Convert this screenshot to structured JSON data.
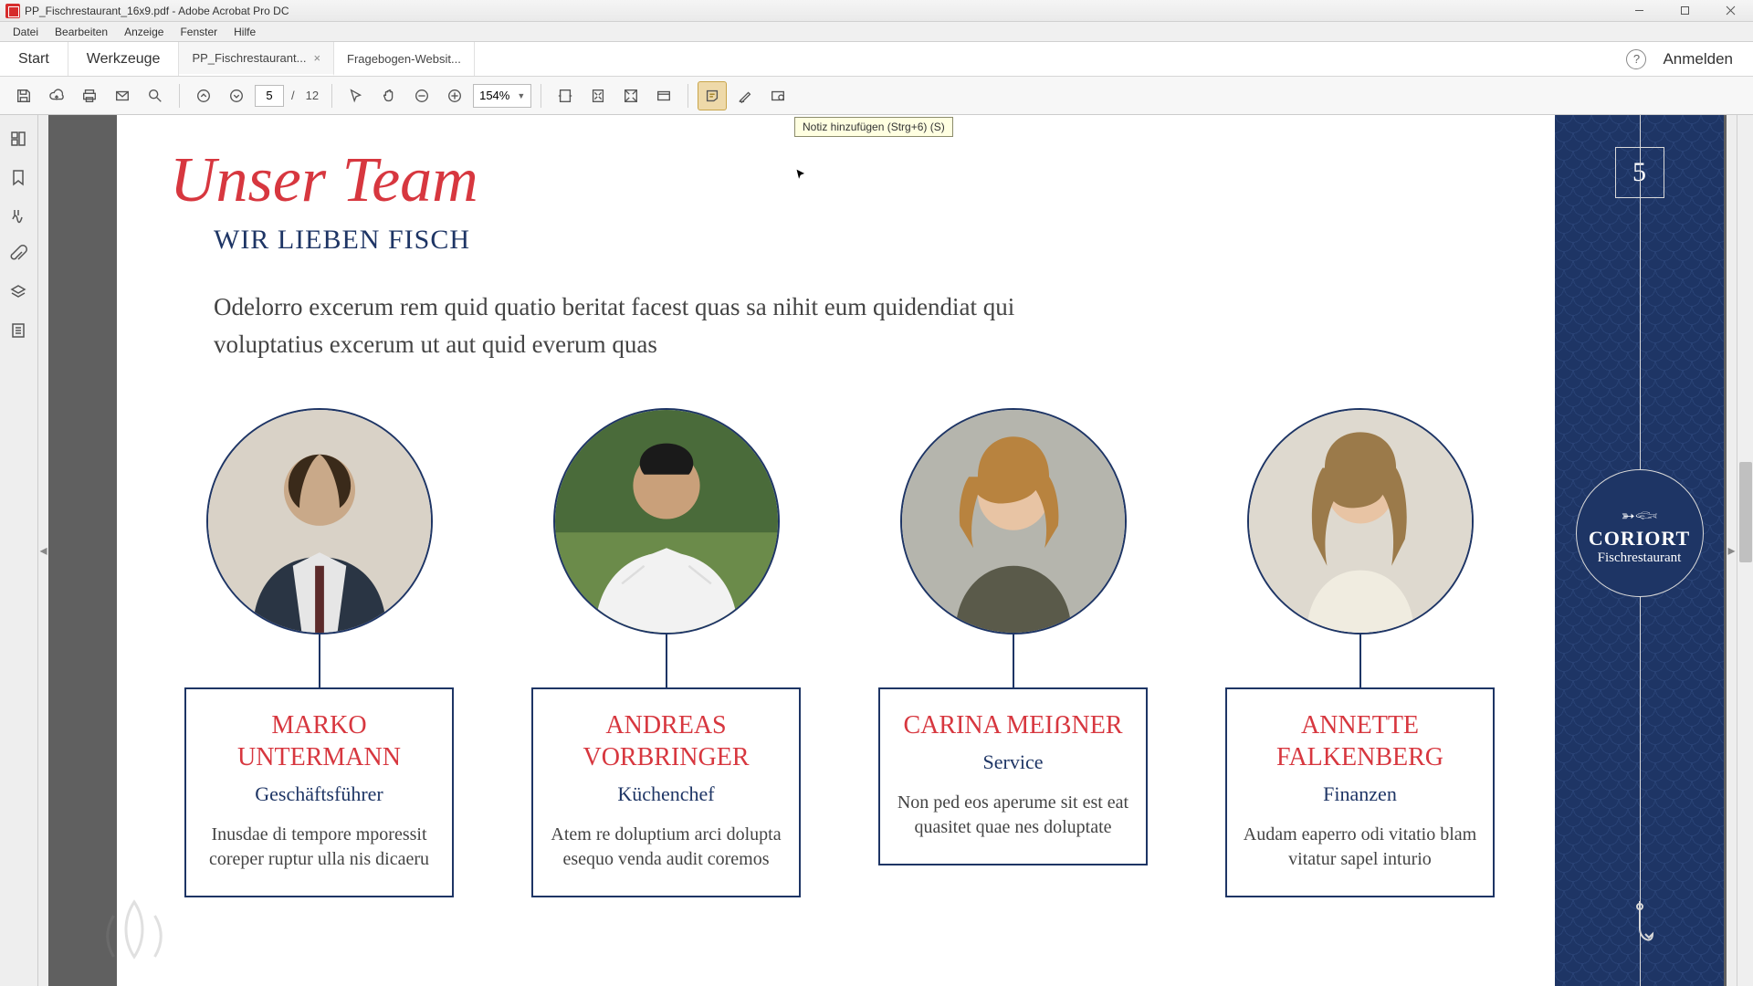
{
  "window": {
    "title": "PP_Fischrestaurant_16x9.pdf - Adobe Acrobat Pro DC",
    "menus": [
      "Datei",
      "Bearbeiten",
      "Anzeige",
      "Fenster",
      "Hilfe"
    ]
  },
  "tabs": {
    "start": "Start",
    "tools": "Werkzeuge",
    "docs": [
      {
        "label": "PP_Fischrestaurant...",
        "active": true
      },
      {
        "label": "Fragebogen-Websit...",
        "active": false
      }
    ],
    "signin": "Anmelden"
  },
  "toolbar": {
    "page_current": "5",
    "page_sep": "/",
    "page_total": "12",
    "zoom": "154%",
    "tooltip": "Notiz hinzufügen (Strg+6) (S)"
  },
  "doc": {
    "title": "Unser Team",
    "subtitle": "WIR LIEBEN FISCH",
    "paragraph": "Odelorro excerum rem quid quatio beritat facest quas sa nihit eum quidendiat qui voluptatius excerum ut aut quid everum quas",
    "pagenum": "5",
    "brand": "CORIORT",
    "brand_sub": "Fischrestaurant",
    "members": [
      {
        "name": "MARKO UNTERMANN",
        "role": "Geschäftsführer",
        "desc": "Inusdae di tempore mporessit coreper ruptur ulla nis dicaeru"
      },
      {
        "name": "ANDREAS VORBRINGER",
        "role": "Küchenchef",
        "desc": "Atem re doluptium arci dolupta esequo venda audit coremos"
      },
      {
        "name": "CARINA MEIẞNER",
        "role": "Service",
        "desc": "Non ped eos aperume sit est eat quasitet quae nes doluptate"
      },
      {
        "name": "ANNETTE FALKENBERG",
        "role": "Finanzen",
        "desc": "Audam eaperro odi vitatio blam vitatur sapel inturio"
      }
    ]
  }
}
